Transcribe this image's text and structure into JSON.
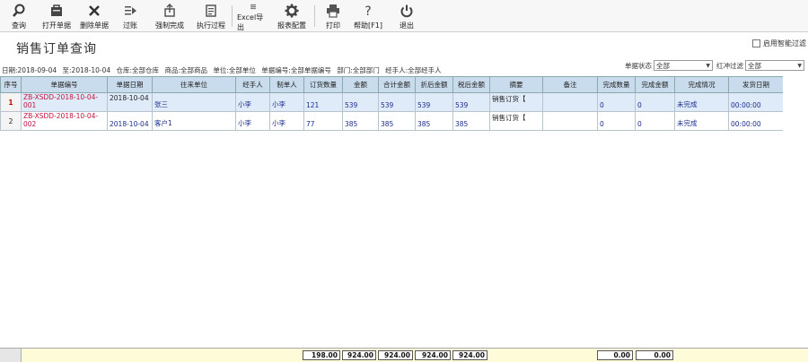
{
  "toolbar": {
    "items": [
      {
        "label": "查询",
        "icon": "search-icon"
      },
      {
        "label": "打开单据",
        "icon": "open-document-icon"
      },
      {
        "label": "删除单据",
        "icon": "delete-icon"
      },
      {
        "label": "过账",
        "icon": "post-icon"
      },
      {
        "label": "强制完成",
        "icon": "force-complete-icon"
      },
      {
        "label": "执行过程",
        "icon": "execute-process-icon"
      },
      {
        "label": "Excel导出",
        "icon": "excel-export-icon"
      },
      {
        "label": "报表配置",
        "icon": "gear-icon"
      },
      {
        "label": "打印",
        "icon": "printer-icon"
      },
      {
        "label": "帮助[F1]",
        "icon": "help-icon"
      },
      {
        "label": "退出",
        "icon": "power-icon"
      }
    ]
  },
  "page": {
    "title": "销售订单查询",
    "smart_filter_label": "启用智能过滤"
  },
  "filters": {
    "date_from": "日期:2018-09-04",
    "date_to": "至:2018-10-04",
    "warehouse": "仓库:全部仓库",
    "product": "商品:全部商品",
    "unit": "单位:全部单位",
    "doc_no": "单据编号:全部单据编号",
    "dept": "部门:全部部门",
    "handler": "经手人:全部经手人"
  },
  "status_filter": {
    "label": "单据状态",
    "value": "全部"
  },
  "redflush_filter": {
    "label": "红冲过滤",
    "value": "全部"
  },
  "table": {
    "headers": [
      "序号",
      "单据编号",
      "单据日期",
      "往来单位",
      "经手人",
      "制单人",
      "订货数量",
      "金额",
      "合计金额",
      "折后金额",
      "税后金额",
      "摘要",
      "备注",
      "完成数量",
      "完成金额",
      "完成情况",
      "发货日期"
    ],
    "rows": [
      {
        "seq": "1",
        "doc_no": "ZB-XSDD-2018-10-04-001",
        "date": "2018-10-04",
        "partner": "张三",
        "handler": "小李",
        "maker": "小李",
        "qty": "121",
        "amount": "539",
        "total": "539",
        "discount": "539",
        "tax": "539",
        "summary": "销售订货【",
        "remark": "",
        "done_qty": "0",
        "done_amt": "0",
        "status": "未完成",
        "ship_date": "00:00:00"
      },
      {
        "seq": "2",
        "doc_no": "ZB-XSDD-2018-10-04-002",
        "date": "2018-10-04",
        "partner": "客户1",
        "handler": "小李",
        "maker": "小李",
        "qty": "77",
        "amount": "385",
        "total": "385",
        "discount": "385",
        "tax": "385",
        "summary": "销售订货【",
        "remark": "",
        "done_qty": "0",
        "done_amt": "0",
        "status": "未完成",
        "ship_date": "00:00:00"
      }
    ]
  },
  "footer": {
    "qty": "198.00",
    "amount": "924.00",
    "total": "924.00",
    "discount": "924.00",
    "tax": "924.00",
    "done_qty": "0.00",
    "done_amt": "0.00"
  }
}
